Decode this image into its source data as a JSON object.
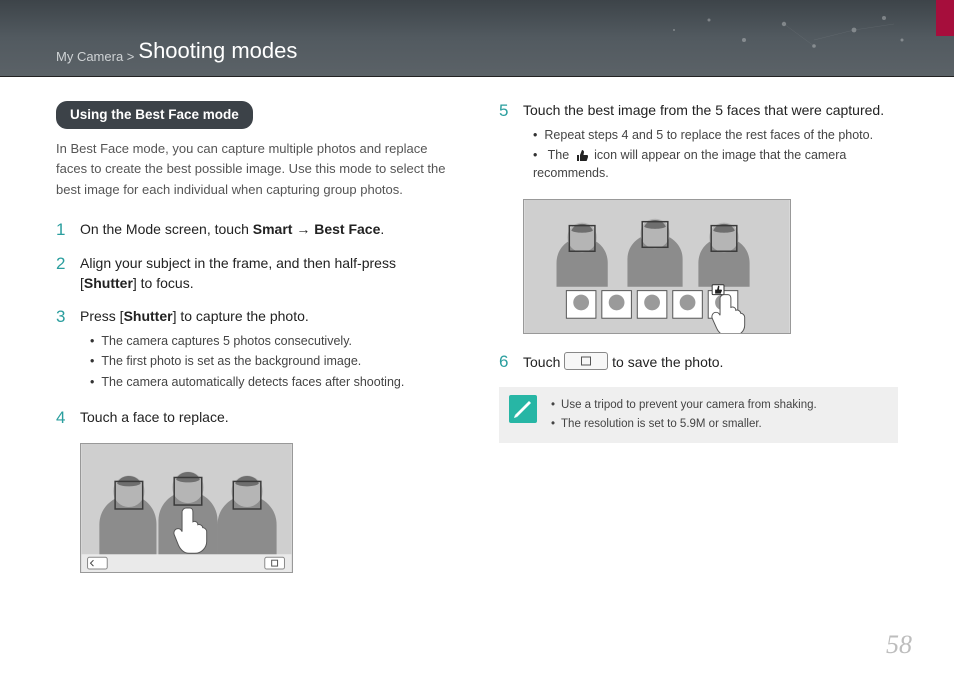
{
  "header": {
    "breadcrumb_small": "My Camera > ",
    "breadcrumb_large": "Shooting modes"
  },
  "section_title": "Using the Best Face mode",
  "intro": "In Best Face mode, you can capture multiple photos and replace faces to create the best possible image. Use this mode to select the best image for each individual when capturing group photos.",
  "steps": {
    "s1_pre": "On the Mode screen, touch ",
    "s1_b1": "Smart",
    "s1_arrow": " → ",
    "s1_b2": "Best Face",
    "s1_post": ".",
    "s2_pre": "Align your subject in the frame, and then half-press [",
    "s2_b": "Shutter",
    "s2_post": "] to focus.",
    "s3_pre": "Press [",
    "s3_b": "Shutter",
    "s3_post": "] to capture the photo.",
    "s3_bullets": [
      "The camera captures 5 photos consecutively.",
      "The first photo is set as the background image.",
      "The camera automatically detects faces after shooting."
    ],
    "s4": "Touch a face to replace.",
    "s5": "Touch the best image from the 5 faces that were captured.",
    "s5_bullets": [
      "Repeat steps 4 and 5 to replace the rest faces of the photo."
    ],
    "s5_icon_pre": "The ",
    "s5_icon_post": " icon will appear on the image that the camera recommends.",
    "s6_pre": "Touch ",
    "s6_post": " to save the photo."
  },
  "tips": [
    "Use a tripod to prevent your camera from shaking.",
    "The resolution is set to 5.9M or smaller."
  ],
  "nums": {
    "n1": "1",
    "n2": "2",
    "n3": "3",
    "n4": "4",
    "n5": "5",
    "n6": "6"
  },
  "page_number": "58"
}
